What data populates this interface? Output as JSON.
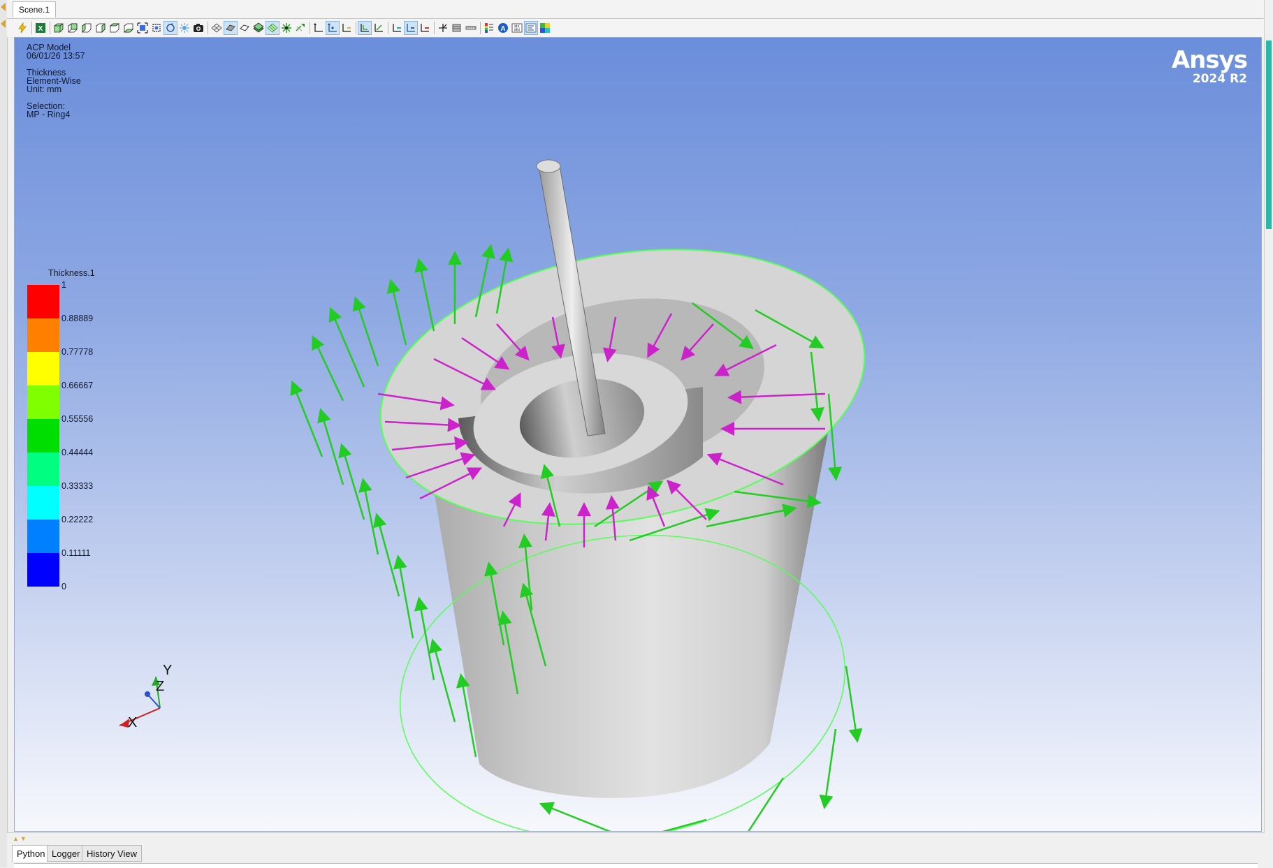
{
  "window": {
    "tab_label": "Scene.1"
  },
  "viewport": {
    "info_lines": [
      "ACP Model",
      "06/01/26 13:57"
    ],
    "result_lines": [
      "Thickness",
      "Element-Wise",
      "Unit: mm"
    ],
    "selection_lines": [
      "Selection:",
      "MP - Ring4"
    ],
    "logo": {
      "brand": "Ansys",
      "version": "2024 R2"
    },
    "triad": {
      "x_label": "X",
      "y_label": "Y",
      "z_label": "Z"
    }
  },
  "legend": {
    "title": "Thickness.1",
    "labels": [
      "1",
      "0.88889",
      "0.77778",
      "0.66667",
      "0.55556",
      "0.44444",
      "0.33333",
      "0.22222",
      "0.11111",
      "0"
    ],
    "colors": [
      "#ff0000",
      "#ff8000",
      "#ffff00",
      "#80ff00",
      "#00dd00",
      "#00ff80",
      "#00ffff",
      "#0080ff",
      "#0000ff"
    ]
  },
  "bottom_tabs": [
    "Python",
    "Logger",
    "History View"
  ],
  "colors": {
    "fiber_arrows": "#22cc22",
    "normal_arrows": "#cc22cc",
    "accent": "#2ab8a8"
  }
}
